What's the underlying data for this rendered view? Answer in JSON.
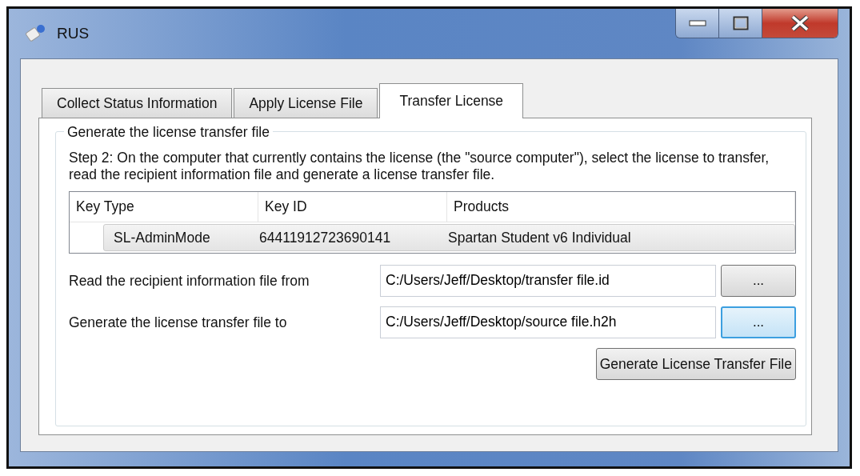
{
  "window": {
    "title": "RUS"
  },
  "tabs": [
    {
      "label": "Collect Status Information",
      "selected": false
    },
    {
      "label": "Apply License File",
      "selected": false
    },
    {
      "label": "Transfer License",
      "selected": true
    }
  ],
  "group": {
    "title": "Generate the license transfer file",
    "instructions": "Step 2: On the computer that currently contains the license (the \"source computer\"), select the license to transfer, read the recipient information file and generate a license transfer file."
  },
  "table": {
    "columns": [
      "Key Type",
      "Key ID",
      "Products"
    ],
    "rows": [
      {
        "cells": [
          "SL-AdminMode",
          "64411912723690141",
          "Spartan Student v6 Individual"
        ],
        "selected": true
      }
    ]
  },
  "fields": [
    {
      "label": "Read the recipient information file from",
      "value": "C:/Users/Jeff/Desktop/transfer file.id",
      "button": "...",
      "focused": false
    },
    {
      "label": "Generate the license transfer file to",
      "value": "C:/Users/Jeff/Desktop/source file.h2h",
      "button": "...",
      "focused": true
    }
  ],
  "action_button": "Generate License Transfer File"
}
